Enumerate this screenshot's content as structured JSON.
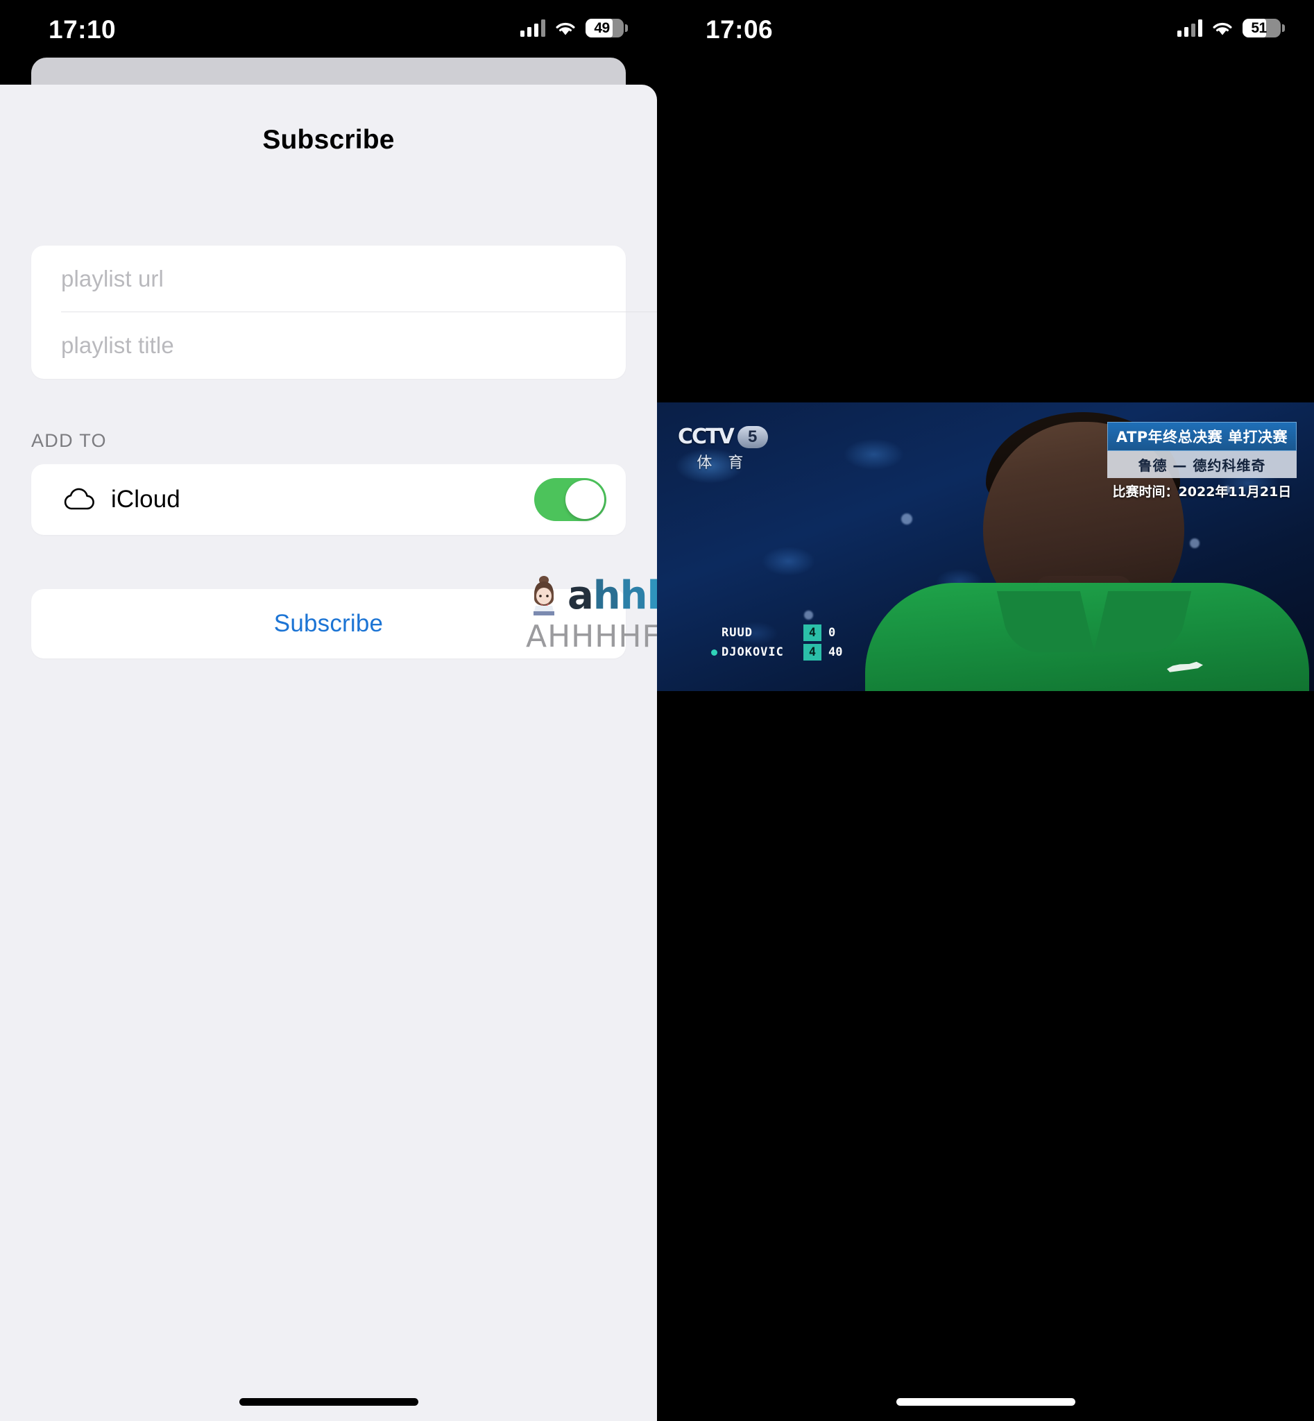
{
  "left_screen": {
    "status_bar": {
      "time": "17:10",
      "battery_level": "49",
      "signal_icon": "cellular-signal-icon",
      "wifi_icon": "wifi-icon",
      "battery_icon": "battery-icon"
    },
    "sheet": {
      "title": "Subscribe",
      "fields": [
        {
          "name": "playlist-url",
          "placeholder": "playlist url",
          "value": ""
        },
        {
          "name": "playlist-title",
          "placeholder": "playlist title",
          "value": ""
        }
      ],
      "section_header": "ADD TO",
      "icloud_row": {
        "icon": "cloud-icon",
        "label": "iCloud",
        "toggle_state": "on",
        "toggle_color": "#4CC35B"
      },
      "action_button": {
        "label": "Subscribe",
        "color": "#1C74D4"
      },
      "background_color": "#F0F0F4",
      "card_color": "#FFFFFF"
    },
    "watermark": {
      "logo_text": "ahhhhfs",
      "domain_text": "AHHHHFS.COM",
      "mascot_icon": "girl-avatar-icon"
    }
  },
  "right_screen": {
    "status_bar": {
      "time": "17:06",
      "battery_level": "51",
      "signal_icon": "cellular-signal-icon",
      "wifi_icon": "wifi-icon",
      "battery_icon": "battery-icon"
    },
    "video": {
      "channel_logo": "CCTV",
      "channel_number": "5",
      "channel_subtitle": "体 育",
      "banner": {
        "title": "ATP年终总决赛 单打决赛",
        "players": "鲁德 — 德约科维奇",
        "date_line": "比赛时间：2022年11月21日"
      },
      "scoreboard": {
        "rows": [
          {
            "player": "RUUD",
            "set": "4",
            "points": "0",
            "serving": false
          },
          {
            "player": "DJOKOVIC",
            "set": "4",
            "points": "40",
            "serving": true
          }
        ],
        "accent_color": "#2BBFA8"
      }
    }
  }
}
